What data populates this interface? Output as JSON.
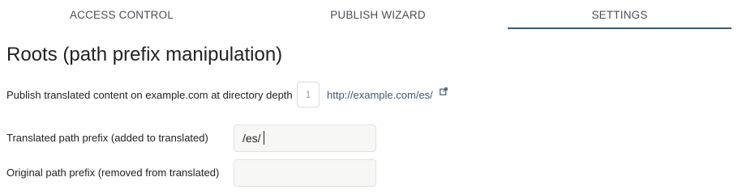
{
  "tabs": [
    {
      "label": "ACCESS CONTROL"
    },
    {
      "label": "PUBLISH WIZARD"
    },
    {
      "label": "SETTINGS",
      "active": true
    }
  ],
  "section": {
    "title": "Roots (path prefix manipulation)"
  },
  "depth_row": {
    "label": "Publish translated content on example.com at directory depth",
    "depth_value": "1",
    "link_text": "http://example.com/es/",
    "link_icon": "external-link-icon"
  },
  "translated_prefix": {
    "label": "Translated path prefix (added to translated)",
    "value": "/es/"
  },
  "original_prefix": {
    "label": "Original path prefix (removed from translated)",
    "value": ""
  },
  "colors": {
    "accent": "#3d5a73",
    "field_bg": "#f7f7f6"
  }
}
